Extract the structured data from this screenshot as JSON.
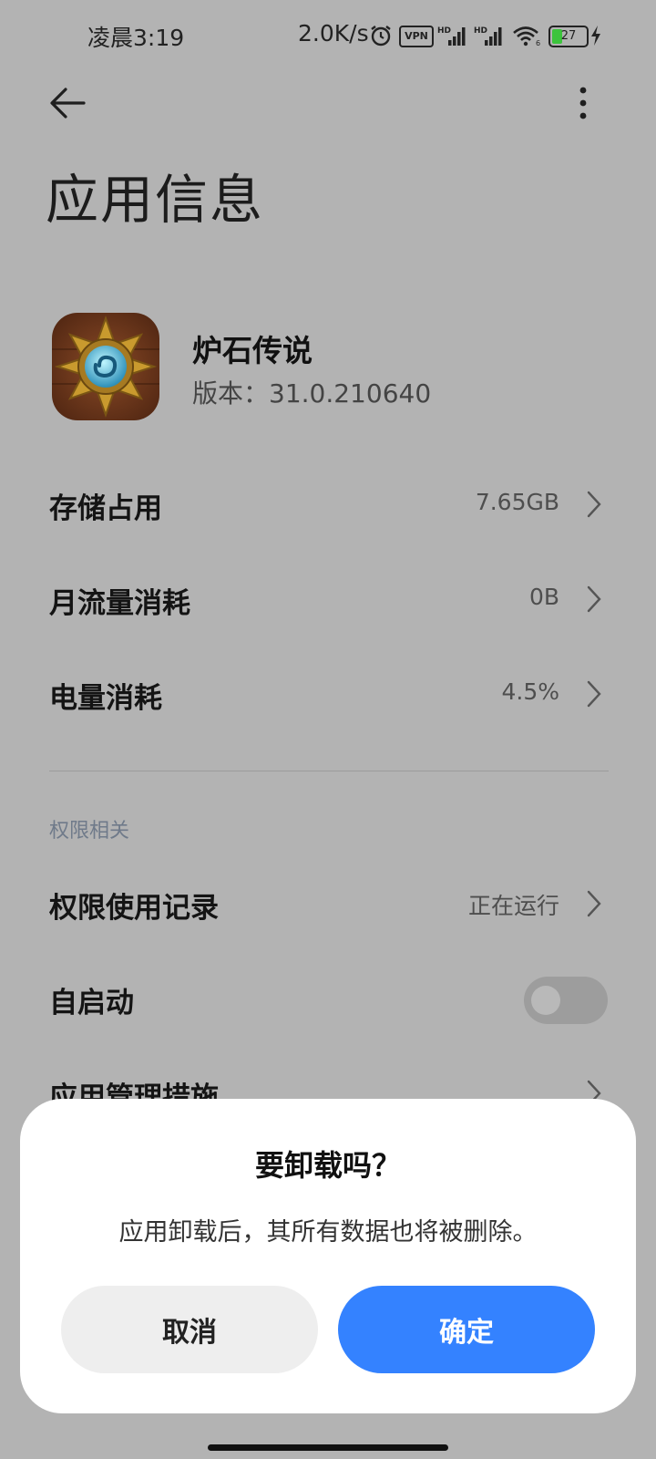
{
  "status_bar": {
    "time": "凌晨3:19",
    "network_speed": "2.0K/s",
    "vpn_label": "VPN",
    "battery": "27",
    "icons": [
      "alarm-icon",
      "vpn-icon",
      "signal-hd-icon",
      "signal-hd-icon",
      "wifi-icon",
      "battery-icon",
      "charging-icon"
    ]
  },
  "header": {
    "back_icon": "back-arrow-icon",
    "more_icon": "more-vertical-icon",
    "title": "应用信息"
  },
  "app": {
    "name": "炉石传说",
    "version": "版本：31.0.210640"
  },
  "rows": [
    {
      "label": "存储占用",
      "value": "7.65GB"
    },
    {
      "label": "月流量消耗",
      "value": "0B"
    },
    {
      "label": "电量消耗",
      "value": "4.5%"
    }
  ],
  "permissions": {
    "section_title": "权限相关",
    "usage_record": {
      "label": "权限使用记录",
      "value": "正在运行"
    },
    "autostart": {
      "label": "自启动",
      "enabled": false
    },
    "management": {
      "label": "应用管理措施"
    }
  },
  "dialog": {
    "title": "要卸载吗？",
    "message": "应用卸载后，其所有数据也将被删除。",
    "cancel_label": "取消",
    "confirm_label": "确定"
  },
  "colors": {
    "dim_background": "#b3b3b3",
    "accent": "#3482ff",
    "dialog_bg": "#ffffff",
    "cancel_bg": "#eeeeee"
  }
}
